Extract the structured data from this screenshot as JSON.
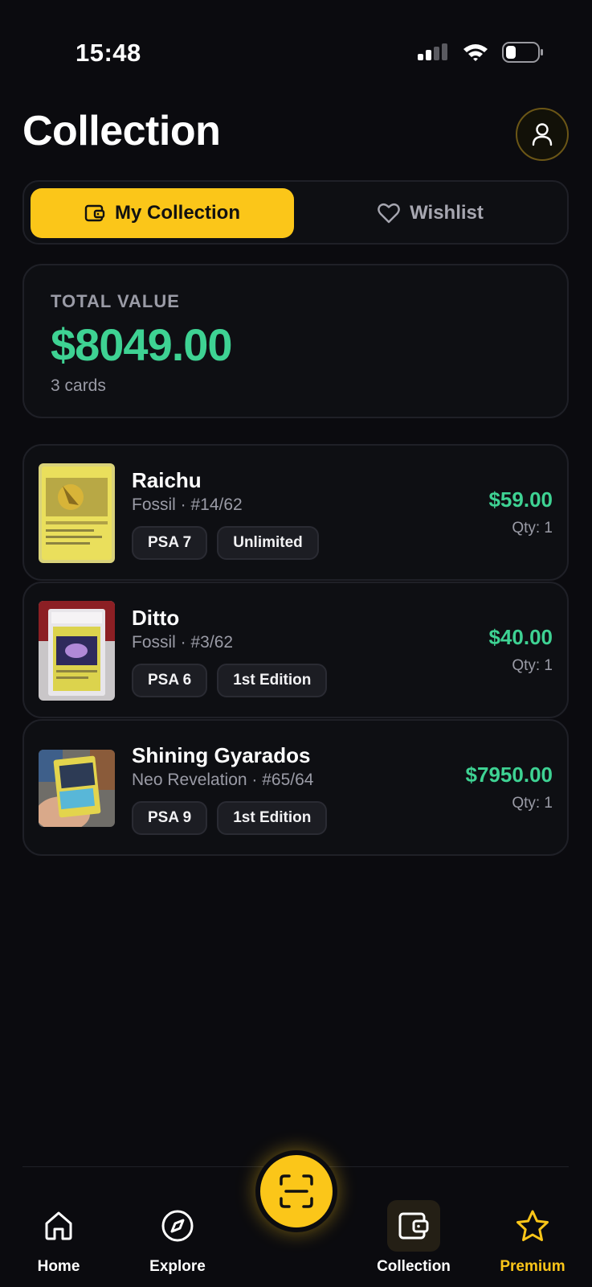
{
  "status": {
    "time": "15:48"
  },
  "header": {
    "title": "Collection"
  },
  "tabs": {
    "active_label": "My Collection",
    "inactive_label": "Wishlist"
  },
  "summary": {
    "label": "TOTAL VALUE",
    "value": "$8049.00",
    "count": "3 cards"
  },
  "cards": [
    {
      "name": "Raichu",
      "set": "Fossil · #14/62",
      "grade": "PSA 7",
      "edition": "Unlimited",
      "price": "$59.00",
      "qty": "Qty: 1"
    },
    {
      "name": "Ditto",
      "set": "Fossil · #3/62",
      "grade": "PSA 6",
      "edition": "1st Edition",
      "price": "$40.00",
      "qty": "Qty: 1"
    },
    {
      "name": "Shining Gyarados",
      "set": "Neo Revelation · #65/64",
      "grade": "PSA 9",
      "edition": "1st Edition",
      "price": "$7950.00",
      "qty": "Qty: 1"
    }
  ],
  "nav": {
    "home": "Home",
    "explore": "Explore",
    "collection": "Collection",
    "premium": "Premium"
  },
  "colors": {
    "accent": "#fbc619",
    "price": "#3ed293",
    "background": "#0b0b0f",
    "muted": "#9a9ba6"
  }
}
